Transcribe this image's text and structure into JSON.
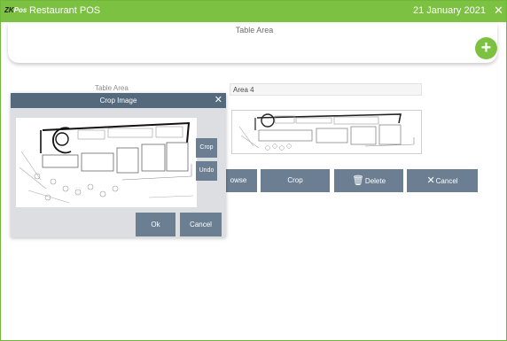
{
  "titlebar": {
    "logo_zk": "ZK",
    "logo_pos": "Pos",
    "app_title": "Restaurant POS",
    "date": "21 January 2021",
    "close_glyph": "✕"
  },
  "header": {
    "title": "Table Area",
    "add_glyph": "+"
  },
  "form": {
    "label": "Table Area",
    "name_value": "Area 4"
  },
  "buttons": {
    "browse": "owse",
    "crop": "Crop",
    "delete": "Delete",
    "cancel": "Cancel"
  },
  "crop_dialog": {
    "title": "Crop Image",
    "close_glyph": "✕",
    "crop_label": "Crop",
    "undo_label": "Undo",
    "ok_label": "Ok",
    "cancel_label": "Cancel"
  },
  "colors": {
    "titlebar": "#7cc142",
    "button": "#6c7f92",
    "dialog_header": "#55697c",
    "dialog_body": "#dcdee1"
  }
}
